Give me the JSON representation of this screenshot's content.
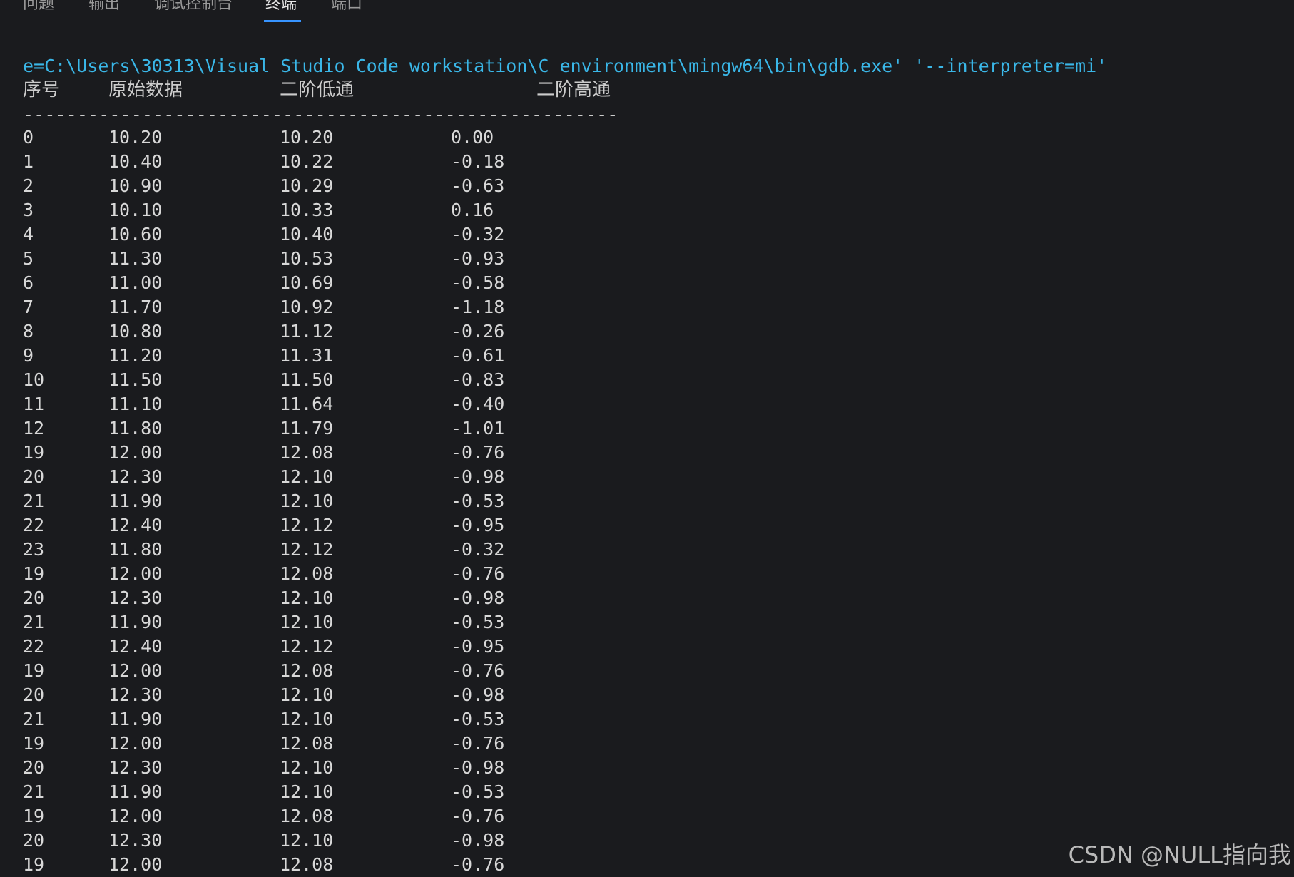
{
  "panel_tabs": [
    {
      "label": "问题",
      "active": false
    },
    {
      "label": "输出",
      "active": false
    },
    {
      "label": "调试控制台",
      "active": false
    },
    {
      "label": "终端",
      "active": true
    },
    {
      "label": "端口",
      "active": false
    }
  ],
  "terminal": {
    "command_line": "e=C:\\Users\\30313\\Visual_Studio_Code_workstation\\C_environment\\mingw64\\bin\\gdb.exe' '--interpreter=mi'",
    "headers": [
      "序号",
      "原始数据",
      "二阶低通",
      "二阶高通"
    ],
    "separator": "-------------------------------------------------------",
    "rows": [
      [
        "0",
        "10.20",
        "10.20",
        "0.00"
      ],
      [
        "1",
        "10.40",
        "10.22",
        "-0.18"
      ],
      [
        "2",
        "10.90",
        "10.29",
        "-0.63"
      ],
      [
        "3",
        "10.10",
        "10.33",
        "0.16"
      ],
      [
        "4",
        "10.60",
        "10.40",
        "-0.32"
      ],
      [
        "5",
        "11.30",
        "10.53",
        "-0.93"
      ],
      [
        "6",
        "11.00",
        "10.69",
        "-0.58"
      ],
      [
        "7",
        "11.70",
        "10.92",
        "-1.18"
      ],
      [
        "8",
        "10.80",
        "11.12",
        "-0.26"
      ],
      [
        "9",
        "11.20",
        "11.31",
        "-0.61"
      ],
      [
        "10",
        "11.50",
        "11.50",
        "-0.83"
      ],
      [
        "11",
        "11.10",
        "11.64",
        "-0.40"
      ],
      [
        "12",
        "11.80",
        "11.79",
        "-1.01"
      ],
      [
        "19",
        "12.00",
        "12.08",
        "-0.76"
      ],
      [
        "20",
        "12.30",
        "12.10",
        "-0.98"
      ],
      [
        "21",
        "11.90",
        "12.10",
        "-0.53"
      ],
      [
        "22",
        "12.40",
        "12.12",
        "-0.95"
      ],
      [
        "23",
        "11.80",
        "12.12",
        "-0.32"
      ],
      [
        "19",
        "12.00",
        "12.08",
        "-0.76"
      ],
      [
        "20",
        "12.30",
        "12.10",
        "-0.98"
      ],
      [
        "21",
        "11.90",
        "12.10",
        "-0.53"
      ],
      [
        "22",
        "12.40",
        "12.12",
        "-0.95"
      ],
      [
        "19",
        "12.00",
        "12.08",
        "-0.76"
      ],
      [
        "20",
        "12.30",
        "12.10",
        "-0.98"
      ],
      [
        "21",
        "11.90",
        "12.10",
        "-0.53"
      ],
      [
        "19",
        "12.00",
        "12.08",
        "-0.76"
      ],
      [
        "20",
        "12.30",
        "12.10",
        "-0.98"
      ],
      [
        "21",
        "11.90",
        "12.10",
        "-0.53"
      ],
      [
        "19",
        "12.00",
        "12.08",
        "-0.76"
      ],
      [
        "20",
        "12.30",
        "12.10",
        "-0.98"
      ],
      [
        "19",
        "12.00",
        "12.08",
        "-0.76"
      ]
    ]
  },
  "watermark": "CSDN @NULL指向我",
  "colors": {
    "background": "#1a1b1e",
    "command_text": "#3ab7e8",
    "active_tab_underline": "#3794ff",
    "output_text": "#d8d8d8"
  }
}
